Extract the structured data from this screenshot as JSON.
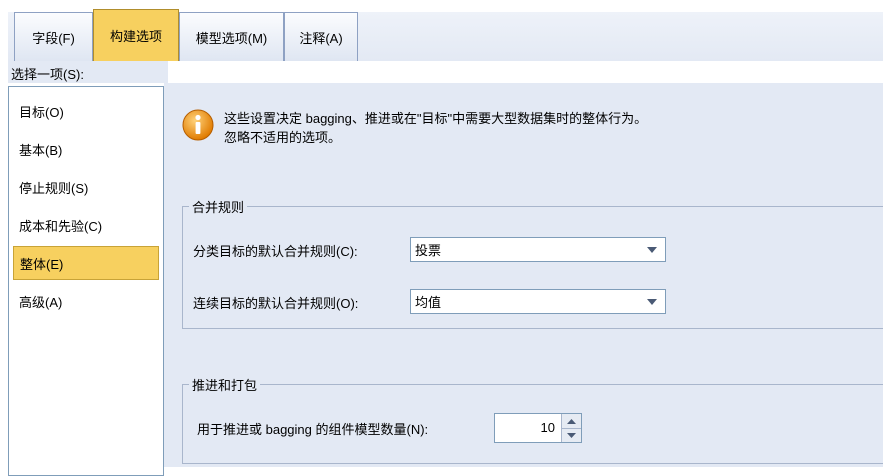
{
  "tabs": [
    {
      "label": "字段(F)"
    },
    {
      "label": "构建选项"
    },
    {
      "label": "模型选项(M)"
    },
    {
      "label": "注释(A)"
    }
  ],
  "select_label": "选择一项(S):",
  "left_items": [
    {
      "label": "目标(O)"
    },
    {
      "label": "基本(B)"
    },
    {
      "label": "停止规则(S)"
    },
    {
      "label": "成本和先验(C)"
    },
    {
      "label": "整体(E)"
    },
    {
      "label": "高级(A)"
    }
  ],
  "info": {
    "line1": "这些设置决定 bagging、推进或在\"目标\"中需要大型数据集时的整体行为。",
    "line2": "忽略不适用的选项。"
  },
  "combine_rules": {
    "legend": "合并规则",
    "categorical_label": "分类目标的默认合并规则(C):",
    "categorical_value": "投票",
    "continuous_label": "连续目标的默认合并规则(O):",
    "continuous_value": "均值"
  },
  "boosting": {
    "legend": "推进和打包",
    "count_label": "用于推进或 bagging 的组件模型数量(N):",
    "count_value": "10"
  },
  "colors": {
    "selected": "#f7d05f",
    "panel_bg": "#e3e9f4",
    "border": "#7f9db9"
  },
  "icons": {
    "info": "info-icon",
    "dropdown": "chevron-down-icon",
    "spin_up": "spin-up-icon",
    "spin_down": "spin-down-icon"
  }
}
